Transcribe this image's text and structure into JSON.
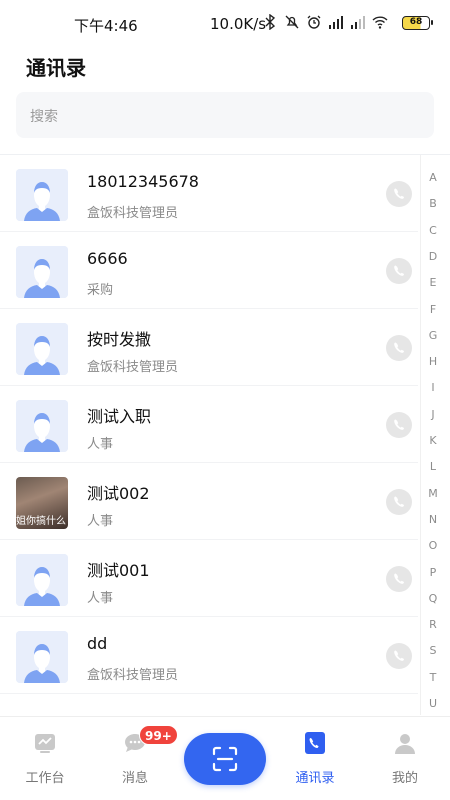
{
  "status_bar": {
    "time": "下午4:46",
    "network_speed": "10.0K/s",
    "battery": "68"
  },
  "header": {
    "title": "通讯录"
  },
  "search": {
    "placeholder": "搜索"
  },
  "contacts": [
    {
      "name": "18012345678",
      "role": "盒饭科技管理员",
      "avatar": "default-avatar"
    },
    {
      "name": "6666",
      "role": "采购",
      "avatar": "default-avatar"
    },
    {
      "name": "按时发撒",
      "role": "盒饭科技管理员",
      "avatar": "default-avatar"
    },
    {
      "name": "测试入职",
      "role": "人事",
      "avatar": "default-avatar"
    },
    {
      "name": "测试002",
      "role": "人事",
      "avatar": "photo-avatar",
      "avatar_caption": "姐你搞什么"
    },
    {
      "name": "测试001",
      "role": "人事",
      "avatar": "default-avatar"
    },
    {
      "name": "dd",
      "role": "盒饭科技管理员",
      "avatar": "default-avatar"
    }
  ],
  "alphabet_index": [
    "A",
    "B",
    "C",
    "D",
    "E",
    "F",
    "G",
    "H",
    "I",
    "J",
    "K",
    "L",
    "M",
    "N",
    "O",
    "P",
    "Q",
    "R",
    "S",
    "T",
    "U"
  ],
  "bottom_nav": {
    "items": [
      {
        "label": "工作台",
        "icon": "workbench-icon"
      },
      {
        "label": "消息",
        "icon": "message-icon",
        "badge": "99+"
      },
      {
        "label": "",
        "icon": "scan-icon"
      },
      {
        "label": "通讯录",
        "icon": "contacts-icon",
        "active": true
      },
      {
        "label": "我的",
        "icon": "profile-icon"
      }
    ]
  },
  "colors": {
    "accent": "#3366f0",
    "badge": "#f0433c",
    "avatar_bg": "#e8eefb"
  }
}
